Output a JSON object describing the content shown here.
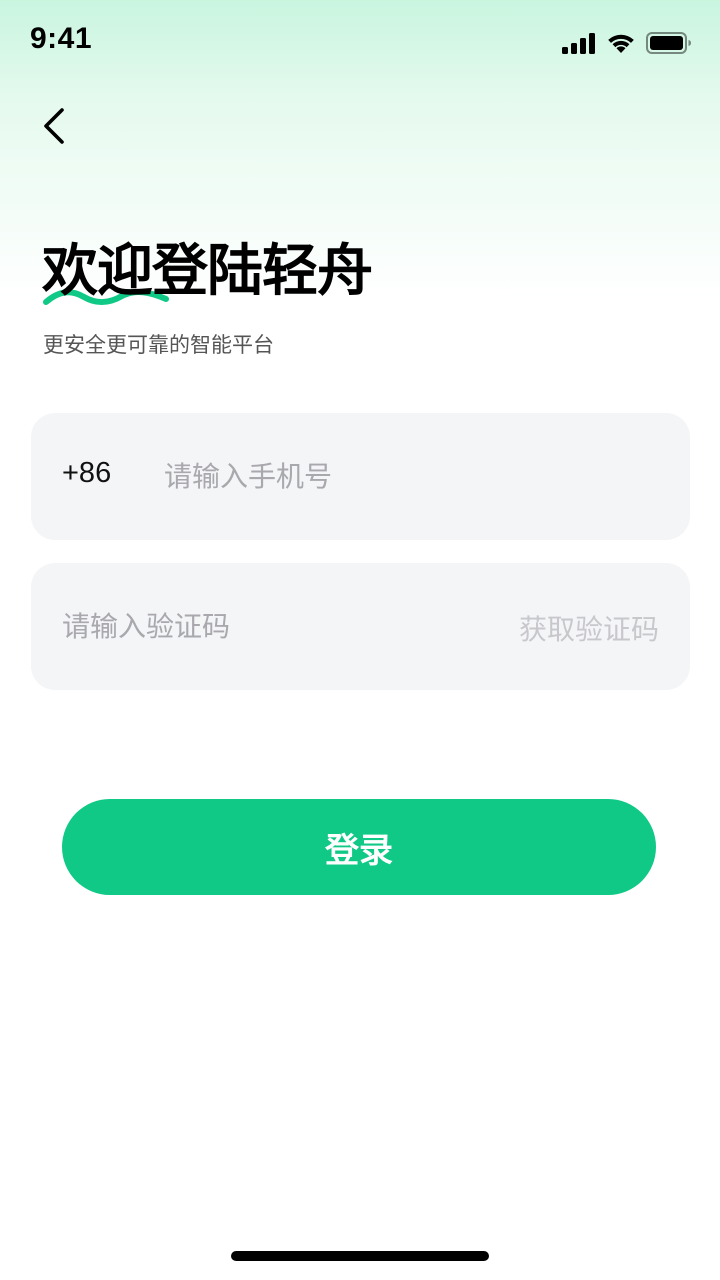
{
  "status_bar": {
    "time": "9:41",
    "icons": [
      "cellular-signal-icon",
      "wifi-icon",
      "battery-icon"
    ]
  },
  "nav": {
    "back_icon": "chevron-left-icon"
  },
  "header": {
    "title": "欢迎登陆轻舟",
    "subtitle": "更安全更可靠的智能平台"
  },
  "form": {
    "phone": {
      "country_code": "+86",
      "value": "",
      "placeholder": "请输入手机号"
    },
    "code": {
      "value": "",
      "placeholder": "请输入验证码",
      "get_code_label": "获取验证码"
    },
    "login_label": "登录"
  },
  "colors": {
    "accent": "#10c986",
    "header_gradient_top": "#c9f5df",
    "input_bg": "#f4f5f7",
    "placeholder": "#a8a8ad",
    "disabled_text": "#c8c8cc"
  }
}
